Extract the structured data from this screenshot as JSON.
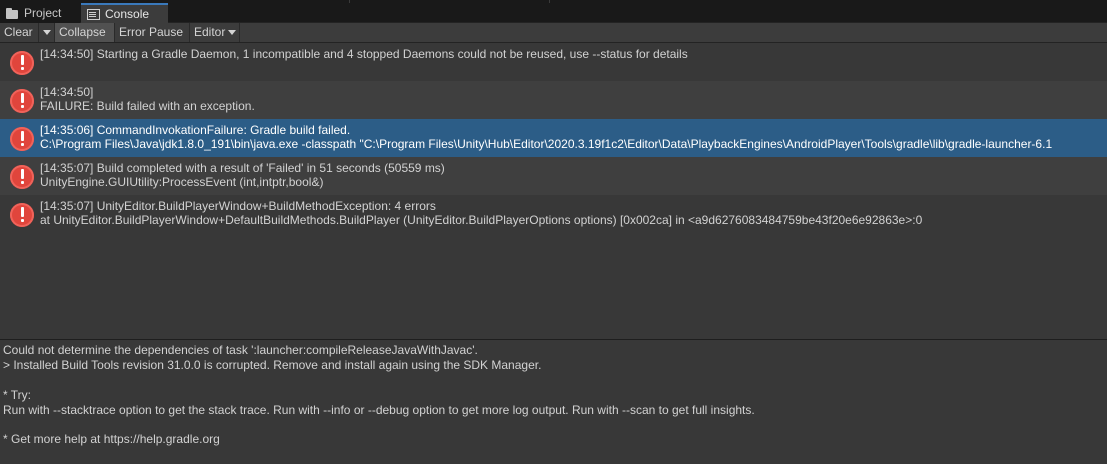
{
  "tabs": [
    {
      "label": "Project",
      "icon": "folder-icon",
      "active": false
    },
    {
      "label": "Console",
      "icon": "console-icon",
      "active": true
    }
  ],
  "toolbar": {
    "clear_label": "Clear",
    "collapse_label": "Collapse",
    "error_pause_label": "Error Pause",
    "editor_label": "Editor"
  },
  "logs": [
    {
      "line1": "[14:34:50] Starting a Gradle Daemon, 1 incompatible and 4 stopped Daemons could not be reused, use --status for details",
      "line2": "",
      "selected": false
    },
    {
      "line1": "[14:34:50]",
      "line2": "FAILURE: Build failed with an exception.",
      "selected": false
    },
    {
      "line1": "[14:35:06] CommandInvokationFailure: Gradle build failed.",
      "line2": "C:\\Program Files\\Java\\jdk1.8.0_191\\bin\\java.exe -classpath \"C:\\Program Files\\Unity\\Hub\\Editor\\2020.3.19f1c2\\Editor\\Data\\PlaybackEngines\\AndroidPlayer\\Tools\\gradle\\lib\\gradle-launcher-6.1",
      "selected": true
    },
    {
      "line1": "[14:35:07] Build completed with a result of 'Failed' in 51 seconds (50559 ms)",
      "line2": "UnityEngine.GUIUtility:ProcessEvent (int,intptr,bool&)",
      "selected": false
    },
    {
      "line1": "[14:35:07] UnityEditor.BuildPlayerWindow+BuildMethodException: 4 errors",
      "line2": "  at UnityEditor.BuildPlayerWindow+DefaultBuildMethods.BuildPlayer (UnityEditor.BuildPlayerOptions options) [0x002ca] in <a9d6276083484759be43f20e6e92863e>:0",
      "selected": false
    }
  ],
  "detail": {
    "lines": [
      "Could not determine the dependencies of task ':launcher:compileReleaseJavaWithJavac'.",
      "> Installed Build Tools revision 31.0.0 is corrupted. Remove and install again using the SDK Manager.",
      "",
      "* Try:",
      "Run with --stacktrace option to get the stack trace. Run with --info or --debug option to get more log output. Run with --scan to get full insights.",
      "",
      "* Get more help at https://help.gradle.org"
    ]
  },
  "colors": {
    "selection": "#2c5d87",
    "error_icon": "#e0453c",
    "tab_accent": "#3a79bb"
  }
}
